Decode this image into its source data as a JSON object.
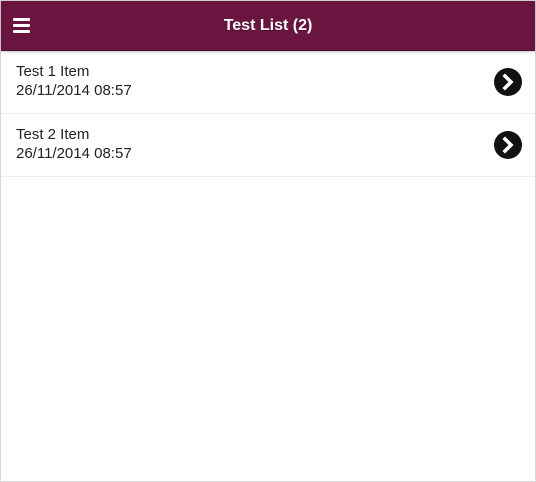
{
  "header": {
    "title": "Test List (2)",
    "menu_icon": "hamburger-menu-icon",
    "background_color": "#6a1440"
  },
  "list": {
    "items": [
      {
        "name": "Test 1 Item",
        "date": "26/11/2014 08:57",
        "icon": "chevron-right-circle-icon"
      },
      {
        "name": "Test 2 Item",
        "date": "26/11/2014 08:57",
        "icon": "chevron-right-circle-icon"
      }
    ]
  }
}
